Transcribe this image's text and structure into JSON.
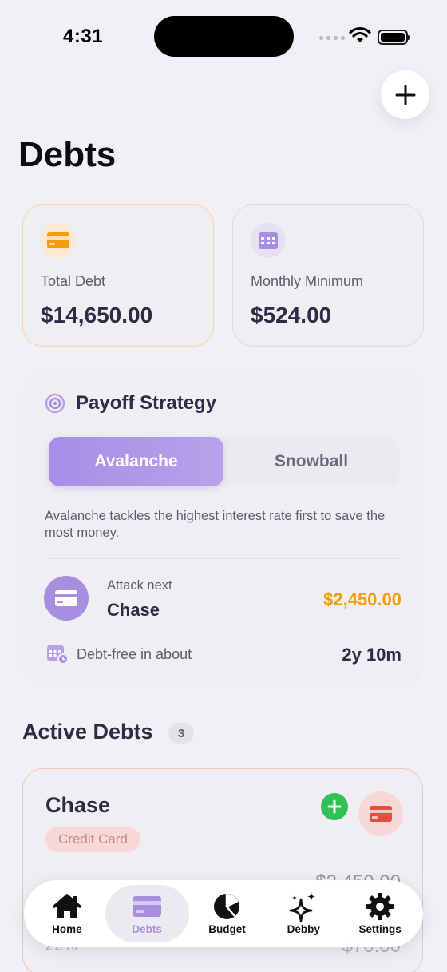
{
  "status_bar": {
    "time": "4:31"
  },
  "header": {
    "title": "Debts",
    "add_button_icon": "plus-icon"
  },
  "summary": {
    "total": {
      "label": "Total Debt",
      "value": "$14,650.00",
      "icon": "credit-card-icon",
      "accent": "#f39c12"
    },
    "monthly": {
      "label": "Monthly Minimum",
      "value": "$524.00",
      "icon": "calendar-icon",
      "accent": "#a88ee0"
    }
  },
  "strategy": {
    "title": "Payoff Strategy",
    "options": [
      "Avalanche",
      "Snowball"
    ],
    "selected": "Avalanche",
    "description": "Avalanche tackles the highest interest rate first to save the most money.",
    "attack_label": "Attack next",
    "attack_name": "Chase",
    "attack_amount": "$2,450.00",
    "debtfree_label": "Debt-free in about",
    "debtfree_value": "2y 10m"
  },
  "active_debts": {
    "title": "Active Debts",
    "count": "3",
    "items": [
      {
        "name": "Chase",
        "type": "Credit Card",
        "balance": "$2,450.00",
        "rate": "22%",
        "minimum": "$70.00",
        "accent": "#e74c3c"
      }
    ]
  },
  "tabbar": {
    "selected": "Debts",
    "tabs": [
      {
        "label": "Home",
        "icon": "home-icon"
      },
      {
        "label": "Debts",
        "icon": "credit-card-icon"
      },
      {
        "label": "Budget",
        "icon": "pie-chart-icon"
      },
      {
        "label": "Debby",
        "icon": "sparkles-icon"
      },
      {
        "label": "Settings",
        "icon": "gear-icon"
      }
    ]
  }
}
